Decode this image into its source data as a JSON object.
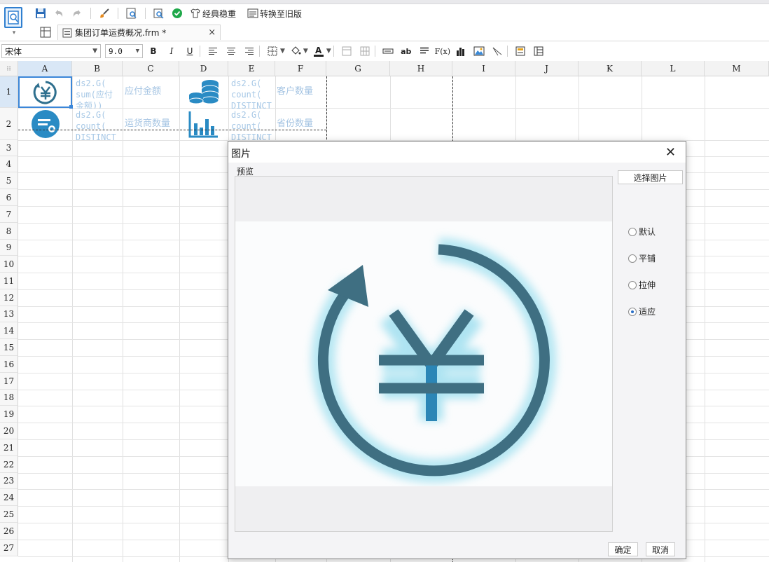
{
  "toolbar": {
    "classic_label": "经典稳重",
    "convert_label": "转换至旧版"
  },
  "tab": {
    "filename": "集团订单运费概况.frm *",
    "close": "×"
  },
  "format": {
    "font": "宋体",
    "size": "9.0",
    "bold": "B",
    "italic": "I",
    "underline": "U",
    "ab": "ab",
    "fx": "F(x)"
  },
  "sheet": {
    "columns": [
      "A",
      "B",
      "C",
      "D",
      "E",
      "F",
      "G",
      "H",
      "I",
      "J",
      "K",
      "L",
      "M"
    ],
    "rows": [
      "1",
      "2",
      "3",
      "4",
      "5",
      "6",
      "7",
      "8",
      "9",
      "10",
      "11",
      "12",
      "13",
      "14",
      "15",
      "16",
      "17",
      "18",
      "19",
      "20",
      "21",
      "22",
      "23",
      "24",
      "25",
      "26",
      "27"
    ],
    "cells": {
      "B1": "ds2.G(\nsum(应付\n金额))",
      "C1": "应付金额",
      "E1": "ds2.G(\ncount(\nDISTINCT",
      "F1": "客户数量",
      "B2": "ds2.G(\ncount(\nDISTINCT",
      "C2": "运货商数量",
      "E2": "ds2.G(\ncount(\nDISTINCT",
      "F2": "省份数量"
    }
  },
  "dialog": {
    "title": "图片",
    "close": "✕",
    "preview_label": "预览",
    "choose_button": "选择图片",
    "options": [
      {
        "label": "默认",
        "checked": false
      },
      {
        "label": "平铺",
        "checked": false
      },
      {
        "label": "拉伸",
        "checked": false
      },
      {
        "label": "适应",
        "checked": true
      }
    ],
    "ok_button": "确定",
    "cancel_button": "取消"
  },
  "colors": {
    "accent": "#2f7fd0",
    "icon_teal": "#2a8bc4",
    "formula_text": "#a7c8e6"
  }
}
